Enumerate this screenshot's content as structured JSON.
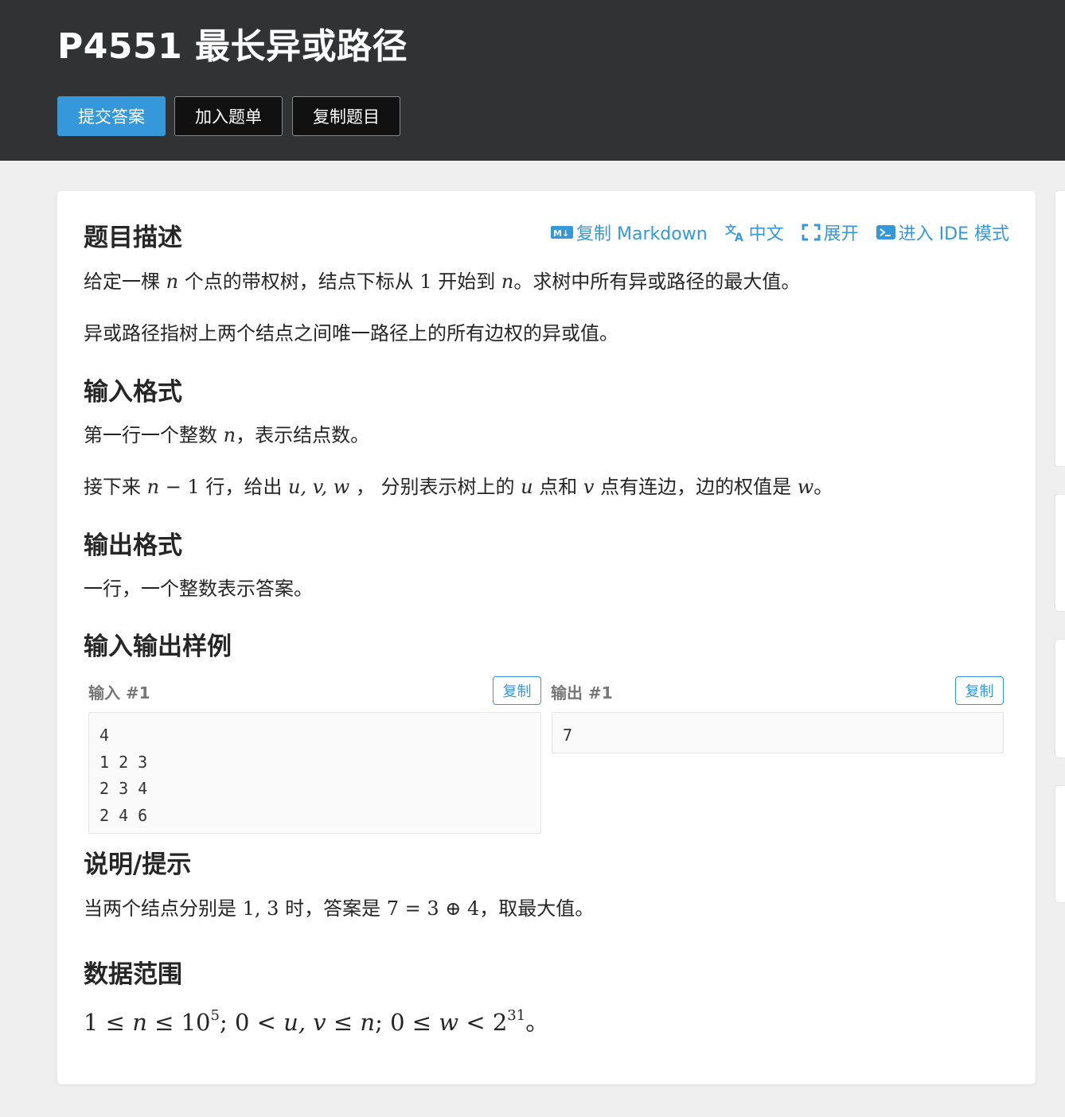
{
  "header": {
    "title": "P4551 最长异或路径",
    "buttons": {
      "submit": "提交答案",
      "add_to_list": "加入题单",
      "copy_problem": "复制题目"
    }
  },
  "toolbar": {
    "copy_markdown": "复制 Markdown",
    "language": "中文",
    "expand": "展开",
    "ide_mode": "进入 IDE 模式"
  },
  "sections": {
    "description": {
      "heading": "题目描述",
      "p1": {
        "a": "给定一棵 ",
        "v1": "n",
        "b": " 个点的带权树，结点下标从 ",
        "v2": "1",
        "c": " 开始到 ",
        "v3": "n",
        "d": "。求树中所有异或路径的最大值。"
      },
      "p2": "异或路径指树上两个结点之间唯一路径上的所有边权的异或值。"
    },
    "input_format": {
      "heading": "输入格式",
      "p1": {
        "a": "第一行一个整数 ",
        "v1": "n",
        "b": "，表示结点数。"
      },
      "p2": {
        "a": "接下来 ",
        "v1": "n",
        "op": " − ",
        "v2": "1",
        "b": " 行，给出 ",
        "v3": "u, v, w",
        "c": " ， 分别表示树上的 ",
        "v4": "u",
        "d": " 点和 ",
        "v5": "v",
        "e": " 点有连边，边的权值是 ",
        "v6": "w",
        "f": "。"
      }
    },
    "output_format": {
      "heading": "输出格式",
      "p1": "一行，一个整数表示答案。"
    },
    "samples": {
      "heading": "输入输出样例",
      "input_label": "输入 #1",
      "output_label": "输出 #1",
      "copy_label": "复制",
      "input_lines": [
        "4",
        "1 2 3",
        "2 3 4",
        "2 4 6"
      ],
      "output_lines": [
        "7"
      ]
    },
    "hint": {
      "heading": "说明/提示",
      "p1": {
        "a": "当两个结点分别是 ",
        "v1": "1, 3",
        "b": " 时，答案是 ",
        "v2": "7 = 3 ⊕ 4",
        "c": "，取最大值。"
      }
    },
    "range": {
      "heading": "数据范围",
      "a": "1 ≤ ",
      "n": "n",
      "b": " ≤ 10",
      "e1": "5",
      "c": "; 0 < ",
      "uv": "u, v",
      "d": " ≤ ",
      "n2": "n",
      "f": "; 0 ≤ ",
      "w": "w",
      "g": " < 2",
      "e2": "31",
      "h": "。"
    }
  }
}
